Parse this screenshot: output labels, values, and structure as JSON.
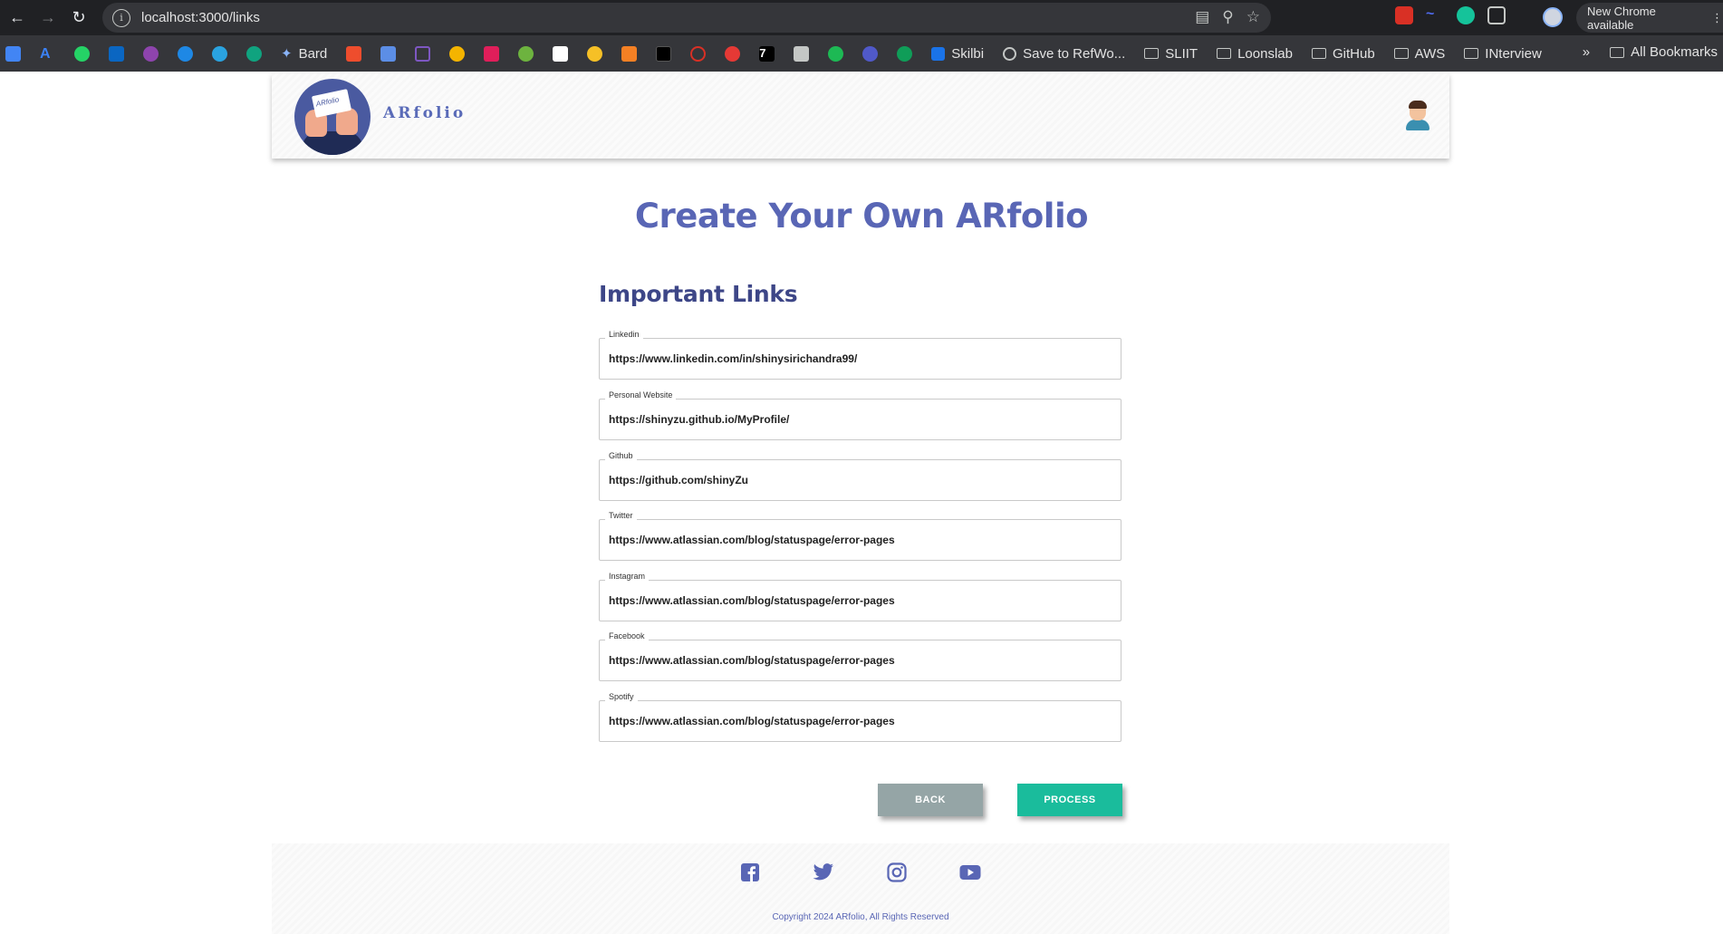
{
  "browser": {
    "url": "localhost:3000/links",
    "update_label": "New Chrome available",
    "bookmarks": [
      {
        "label": "Bard",
        "icon": "bard-icon"
      },
      {
        "label": "Skilbi",
        "icon": "skilbi-icon"
      },
      {
        "label": "Save to RefWo...",
        "icon": "refworks-icon"
      },
      {
        "label": "SLIIT",
        "icon": "folder-icon"
      },
      {
        "label": "Loonslab",
        "icon": "folder-icon"
      },
      {
        "label": "GitHub",
        "icon": "folder-icon"
      },
      {
        "label": "AWS",
        "icon": "folder-icon"
      },
      {
        "label": "INterview",
        "icon": "folder-icon"
      }
    ],
    "all_bookmarks": "All Bookmarks",
    "overflow": "»"
  },
  "header": {
    "brand": "ARfolio",
    "logo_text": "ARfolio"
  },
  "main": {
    "title": "Create Your Own ARfolio",
    "section_title": "Important Links",
    "fields": [
      {
        "label": "Linkedin",
        "value": "https://www.linkedin.com/in/shinysirichandra99/"
      },
      {
        "label": "Personal Website",
        "value": "https://shinyzu.github.io/MyProfile/"
      },
      {
        "label": "Github",
        "value": "https://github.com/shinyZu"
      },
      {
        "label": "Twitter",
        "value": "https://www.atlassian.com/blog/statuspage/error-pages"
      },
      {
        "label": "Instagram",
        "value": "https://www.atlassian.com/blog/statuspage/error-pages"
      },
      {
        "label": "Facebook",
        "value": "https://www.atlassian.com/blog/statuspage/error-pages"
      },
      {
        "label": "Spotify",
        "value": "https://www.atlassian.com/blog/statuspage/error-pages"
      }
    ],
    "back_label": "BACK",
    "process_label": "PROCESS"
  },
  "footer": {
    "copyright": "Copyright 2024 ARfolio, All Rights Reserved",
    "social": [
      "facebook-icon",
      "twitter-icon",
      "instagram-icon",
      "youtube-icon"
    ]
  },
  "colors": {
    "accent": "#5966b5",
    "process": "#1abc9c",
    "back": "#95a5a6"
  }
}
